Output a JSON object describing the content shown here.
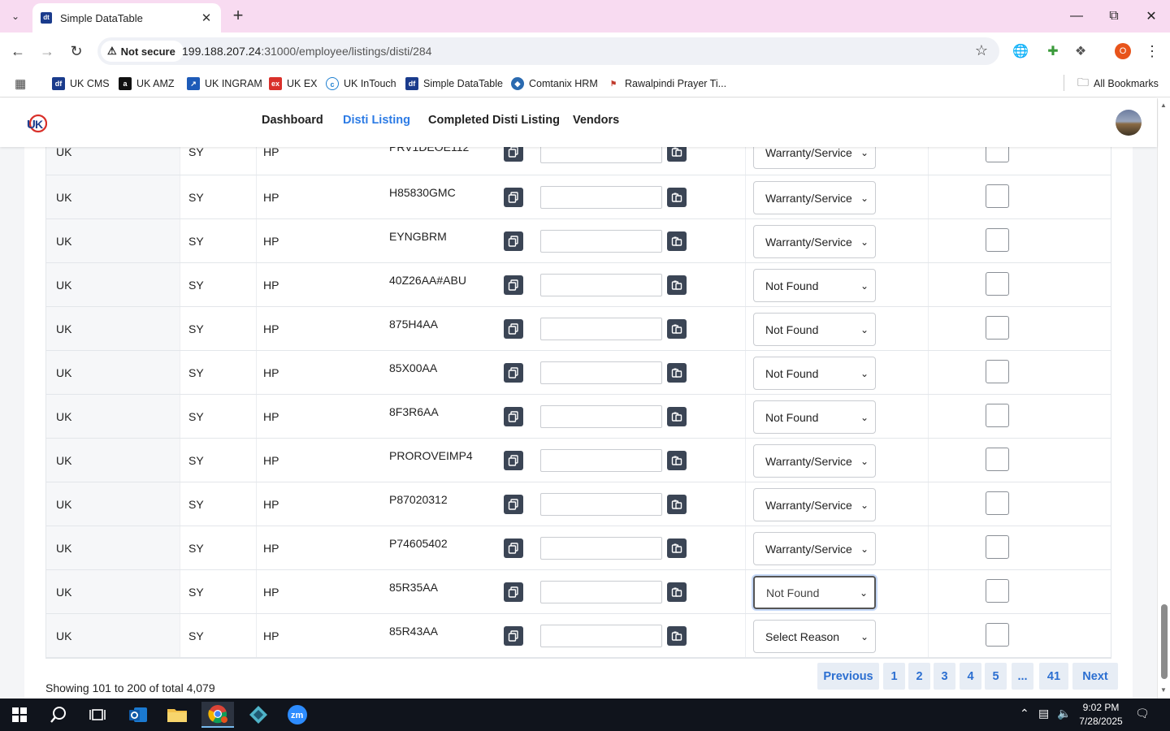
{
  "browser": {
    "tab_title": "Simple DataTable",
    "url_host": "199.188.207.24",
    "url_rest": ":31000/employee/listings/disti/284",
    "security_label": "Not secure",
    "profile_initial": "O",
    "bookmarks": [
      "UK CMS",
      "UK AMZ",
      "UK INGRAM",
      "UK EX",
      "UK InTouch",
      "Simple DataTable",
      "Comtanix HRM",
      "Rawalpindi Prayer Ti..."
    ],
    "all_bookmarks": "All Bookmarks"
  },
  "nav": {
    "items": [
      "Dashboard",
      "Disti Listing",
      "Completed Disti Listing",
      "Vendors"
    ],
    "active": "Disti Listing"
  },
  "table": {
    "rows": [
      {
        "country": "UK",
        "code": "SY",
        "brand": "HP",
        "sku": "PRV1DEOE112",
        "reason": "Warranty/Service"
      },
      {
        "country": "UK",
        "code": "SY",
        "brand": "HP",
        "sku": "H85830GMC",
        "reason": "Warranty/Service"
      },
      {
        "country": "UK",
        "code": "SY",
        "brand": "HP",
        "sku": "EYNGBRM",
        "reason": "Warranty/Service"
      },
      {
        "country": "UK",
        "code": "SY",
        "brand": "HP",
        "sku": "40Z26AA#ABU",
        "reason": "Not Found"
      },
      {
        "country": "UK",
        "code": "SY",
        "brand": "HP",
        "sku": "875H4AA",
        "reason": "Not Found"
      },
      {
        "country": "UK",
        "code": "SY",
        "brand": "HP",
        "sku": "85X00AA",
        "reason": "Not Found"
      },
      {
        "country": "UK",
        "code": "SY",
        "brand": "HP",
        "sku": "8F3R6AA",
        "reason": "Not Found"
      },
      {
        "country": "UK",
        "code": "SY",
        "brand": "HP",
        "sku": "PROROVEIMP4",
        "reason": "Warranty/Service"
      },
      {
        "country": "UK",
        "code": "SY",
        "brand": "HP",
        "sku": "P87020312",
        "reason": "Warranty/Service"
      },
      {
        "country": "UK",
        "code": "SY",
        "brand": "HP",
        "sku": "P74605402",
        "reason": "Warranty/Service"
      },
      {
        "country": "UK",
        "code": "SY",
        "brand": "HP",
        "sku": "85R35AA",
        "reason": "Not Found"
      },
      {
        "country": "UK",
        "code": "SY",
        "brand": "HP",
        "sku": "85R43AA",
        "reason": "Select Reason"
      }
    ]
  },
  "footer": {
    "showing": "Showing 101 to 200 of total 4,079",
    "pagination": [
      "Previous",
      "1",
      "2",
      "3",
      "4",
      "5",
      "...",
      "41",
      "Next"
    ]
  },
  "taskbar": {
    "time": "9:02 PM",
    "date": "7/28/2025"
  },
  "colors": {
    "accent": "#2c7be5",
    "tab_strip": "#f8dbf1",
    "pager_bg": "#e7edf5",
    "copy_btn": "#3b4555"
  }
}
